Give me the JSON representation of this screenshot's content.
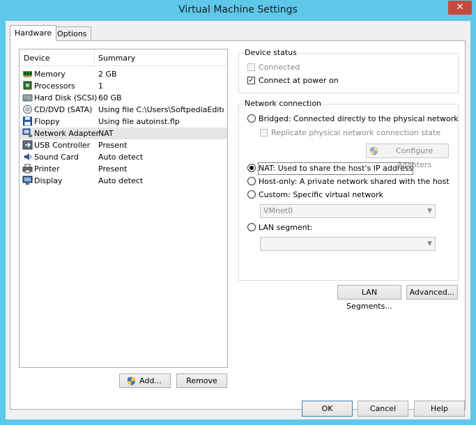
{
  "window": {
    "title": "Virtual Machine Settings",
    "close_glyph": "✕"
  },
  "tabs": [
    {
      "label": "Hardware"
    },
    {
      "label": "Options"
    }
  ],
  "device_list": {
    "header_device": "Device",
    "header_summary": "Summary",
    "rows": [
      {
        "name": "Memory",
        "summary": "2 GB",
        "icon": "memory-icon"
      },
      {
        "name": "Processors",
        "summary": "1",
        "icon": "processor-icon"
      },
      {
        "name": "Hard Disk (SCSI)",
        "summary": "60 GB",
        "icon": "hard-disk-icon"
      },
      {
        "name": "CD/DVD (SATA)",
        "summary": "Using file C:\\Users\\SoftpediaEdito...",
        "icon": "cd-dvd-icon"
      },
      {
        "name": "Floppy",
        "summary": "Using file autoinst.flp",
        "icon": "floppy-icon"
      },
      {
        "name": "Network Adapter",
        "summary": "NAT",
        "icon": "network-adapter-icon"
      },
      {
        "name": "USB Controller",
        "summary": "Present",
        "icon": "usb-icon"
      },
      {
        "name": "Sound Card",
        "summary": "Auto detect",
        "icon": "sound-card-icon"
      },
      {
        "name": "Printer",
        "summary": "Present",
        "icon": "printer-icon"
      },
      {
        "name": "Display",
        "summary": "Auto detect",
        "icon": "display-icon"
      }
    ],
    "selected_index": 5
  },
  "buttons": {
    "add": "Add...",
    "remove": "Remove",
    "lan_segments": "LAN Segments...",
    "advanced": "Advanced...",
    "ok": "OK",
    "cancel": "Cancel",
    "help": "Help",
    "configure_adapters": "Configure Adapters"
  },
  "device_status": {
    "title": "Device status",
    "connected": {
      "label": "Connected",
      "checked": false,
      "disabled": true
    },
    "connect_at_power_on": {
      "label": "Connect at power on",
      "checked": true
    }
  },
  "network_connection": {
    "title": "Network connection",
    "bridged": "Bridged: Connected directly to the physical network",
    "replicate": "Replicate physical network connection state",
    "nat": "NAT: Used to share the host's IP address",
    "host_only": "Host-only: A private network shared with the host",
    "custom": "Custom: Specific virtual network",
    "custom_value": "VMnet0",
    "lan_segment": "LAN segment:",
    "lan_segment_value": "",
    "selected": "nat"
  }
}
